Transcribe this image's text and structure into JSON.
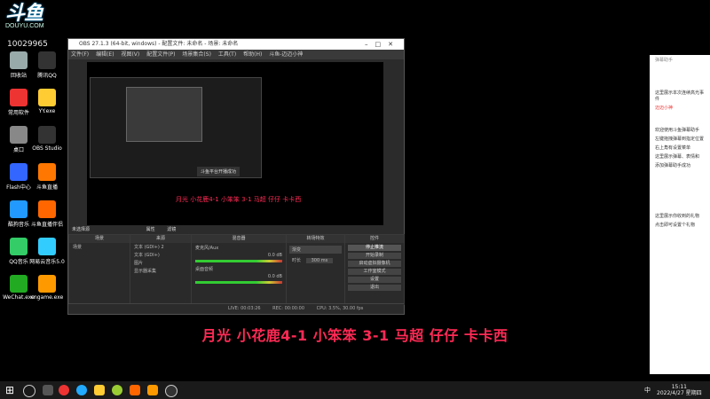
{
  "watermark": {
    "logo": "斗鱼",
    "domain": "DOUYU.COM",
    "room_id": "10029965"
  },
  "desktop_icons": [
    {
      "label": "回收站",
      "name": "recycle-bin-icon",
      "color": "#9aa"
    },
    {
      "label": "腾讯QQ",
      "name": "tencent-qq-icon",
      "color": "#333"
    },
    {
      "label": "常用软件",
      "name": "folder-icon",
      "color": "#e33"
    },
    {
      "label": "YY.exe",
      "name": "yy-icon",
      "color": "#fc3"
    },
    {
      "label": "桌口",
      "name": "desk-icon",
      "color": "#888"
    },
    {
      "label": "OBS Studio",
      "name": "obs-icon",
      "color": "#333"
    },
    {
      "label": "Flash中心",
      "name": "flash-icon",
      "color": "#36f"
    },
    {
      "label": "斗鱼直播",
      "name": "douyu-icon",
      "color": "#f70"
    },
    {
      "label": "酷狗音乐",
      "name": "kugou-icon",
      "color": "#29f"
    },
    {
      "label": "斗鱼直播伴侣",
      "name": "douyu-helper-icon",
      "color": "#f60"
    },
    {
      "label": "QQ音乐",
      "name": "qq-music-icon",
      "color": "#3c6"
    },
    {
      "label": "网易云音乐5.0",
      "name": "netease-music-icon",
      "color": "#3cf"
    },
    {
      "label": "WeChat.exe",
      "name": "wechat-icon",
      "color": "#2a2"
    },
    {
      "label": "cngame.exe",
      "name": "cngame-icon",
      "color": "#f90"
    }
  ],
  "obs": {
    "title": "OBS 27.1.3 (64-bit, windows) - 配置文件: 未命名 - 场景: 未命名",
    "menu": [
      "文件(F)",
      "编辑(E)",
      "视图(V)",
      "配置文件(P)",
      "场景集合(S)",
      "工具(T)",
      "帮助(H)",
      "斗鱼-迈迈小神"
    ],
    "inner_overlay": "月光 小花鹿4-1 小笨笨 3-1 马超 仔仔 卡卡西",
    "nested_toast": "斗鱼平台开播成功",
    "source_label": "未选择源",
    "props_btn": "属性",
    "filters_btn": "滤镜",
    "scenes_header": "场景",
    "scenes": [
      "场景"
    ],
    "sources_header": "来源",
    "sources": [
      "文本 (GDI+) 2",
      "文本 (GDI+)",
      "图片",
      "显示器采集"
    ],
    "mixer_header": "混音器",
    "mixer": [
      {
        "name": "麦克风/Aux",
        "level": "0.0 dB"
      },
      {
        "name": "桌面音频",
        "level": "0.0 dB"
      }
    ],
    "transitions_header": "转场特效",
    "transition_type": "渐变",
    "duration_label": "时长",
    "duration_value": "300 ms",
    "controls_header": "控件",
    "controls": [
      "停止推流",
      "开始录制",
      "启动虚拟摄像机",
      "工作室模式",
      "设置",
      "退出"
    ],
    "status": [
      "LIVE: 00:03:26",
      "REC: 00:00:00",
      "CPU: 3.5%, 30.00 fps"
    ]
  },
  "caption": "月光 小花鹿4-1 小笨笨 3-1 马超 仔仔 卡卡西",
  "chat": {
    "header": "弹幕助手",
    "lines": [
      "这里展示本次连续高光事件",
      "欢迎使用斗鱼弹幕助手",
      "左键拖拽弹幕到指定位置",
      "右上角有设置菜单",
      "这里展示弹幕、表情和",
      "添加弹幕助手成功",
      "这里展示你收到的礼物",
      "点击即可设置个礼物"
    ],
    "user": "迈迈小神"
  },
  "taskbar": {
    "time": "15:11",
    "date": "2022/4/27 星期四",
    "lang": "中"
  }
}
